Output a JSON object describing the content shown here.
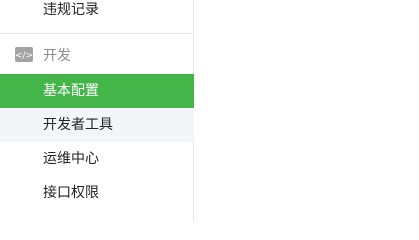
{
  "sidebar": {
    "prev_item": {
      "label": "违规记录"
    },
    "section": {
      "label": "开发",
      "icon": "code-icon"
    },
    "items": [
      {
        "label": "基本配置",
        "state": "active"
      },
      {
        "label": "开发者工具",
        "state": "hover"
      },
      {
        "label": "运维中心",
        "state": "normal"
      },
      {
        "label": "接口权限",
        "state": "normal"
      }
    ]
  },
  "colors": {
    "active_bg": "#44b549",
    "hover_bg": "#f4f5f9",
    "section_text": "#8d8d8d",
    "divider": "#e7e7eb"
  }
}
